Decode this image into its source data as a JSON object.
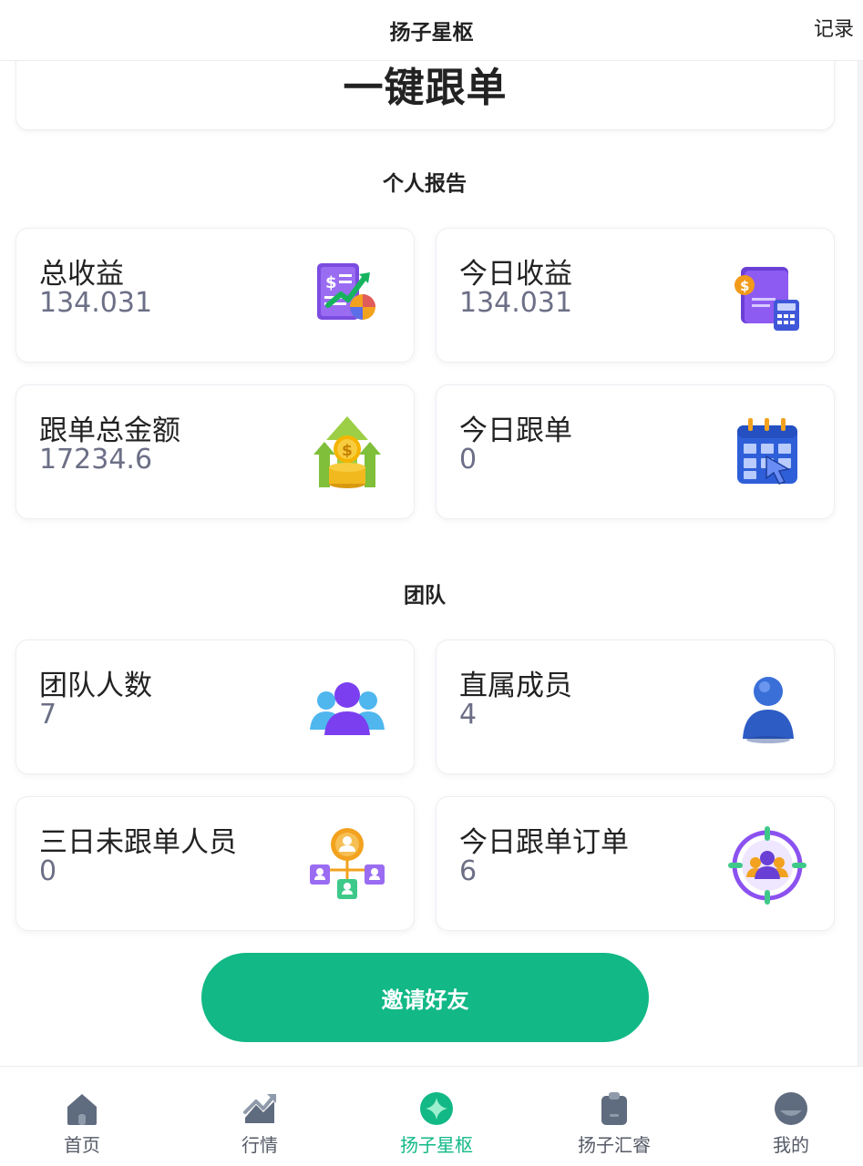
{
  "header": {
    "title": "扬子星枢",
    "action_label": "记录"
  },
  "follow_card": {
    "title": "一键跟单"
  },
  "personal_section": {
    "title": "个人报告",
    "cards": [
      {
        "label": "总收益",
        "value": "134.031",
        "icon": "report-chart-icon"
      },
      {
        "label": "今日收益",
        "value": "134.031",
        "icon": "wallet-calculator-icon"
      },
      {
        "label": "跟单总金额",
        "value": "17234.6",
        "icon": "coins-arrow-up-icon"
      },
      {
        "label": "今日跟单",
        "value": "0",
        "icon": "calendar-click-icon"
      }
    ]
  },
  "team_section": {
    "title": "团队",
    "cards": [
      {
        "label": "团队人数",
        "value": "7",
        "icon": "team-group-icon"
      },
      {
        "label": "直属成员",
        "value": "4",
        "icon": "single-user-icon"
      },
      {
        "label": "三日未跟单人员",
        "value": "0",
        "icon": "user-network-icon"
      },
      {
        "label": "今日跟单订单",
        "value": "6",
        "icon": "target-team-icon"
      }
    ]
  },
  "invite_button": {
    "label": "邀请好友"
  },
  "bottom_nav": {
    "active_color": "#12b886",
    "items": [
      {
        "label": "首页",
        "icon": "home-icon",
        "active": false
      },
      {
        "label": "行情",
        "icon": "trend-chart-icon",
        "active": false
      },
      {
        "label": "扬子星枢",
        "icon": "star-compass-icon",
        "active": true
      },
      {
        "label": "扬子汇睿",
        "icon": "clipboard-icon",
        "active": false
      },
      {
        "label": "我的",
        "icon": "profile-icon",
        "active": false
      }
    ]
  }
}
